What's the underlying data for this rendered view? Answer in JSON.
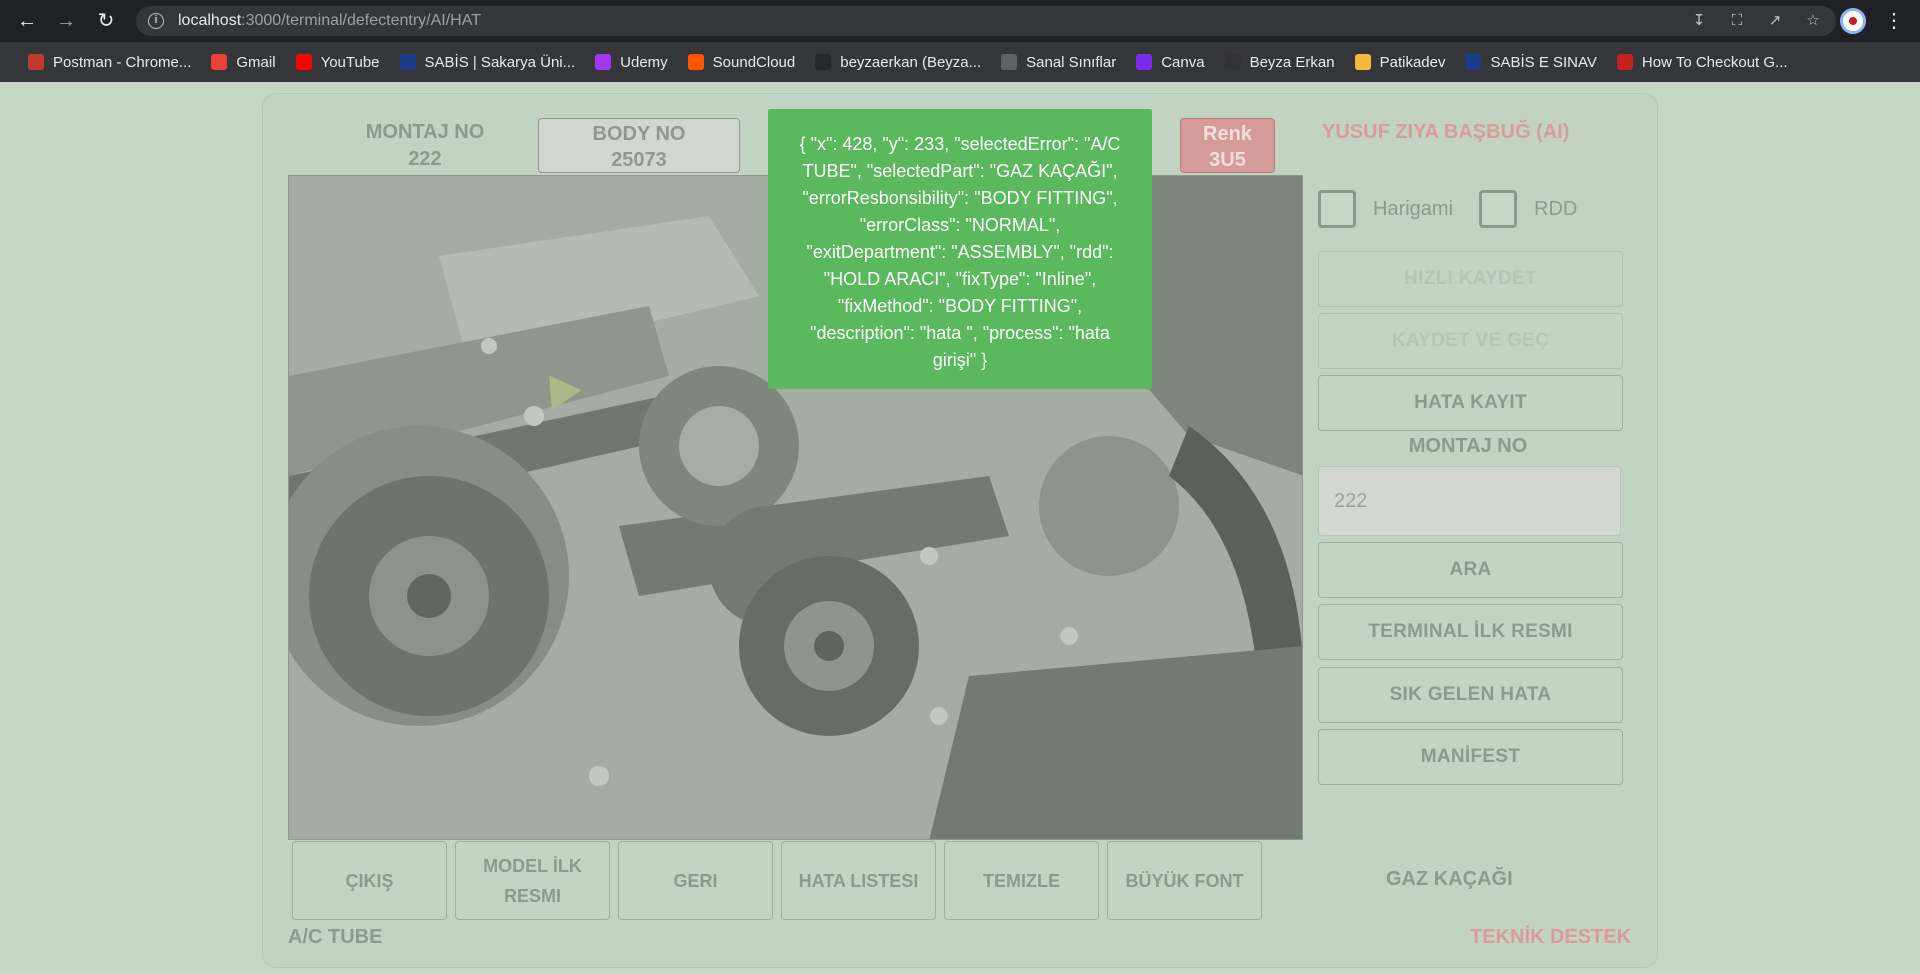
{
  "browser": {
    "url_host": "localhost",
    "url_path": ":3000/terminal/defectentry/AI/HAT",
    "bookmarks": [
      {
        "label": "Postman - Chrome...",
        "icon": "postman-icon",
        "color": "#c0392b"
      },
      {
        "label": "Gmail",
        "icon": "gmail-icon",
        "color": "#ea4335"
      },
      {
        "label": "YouTube",
        "icon": "youtube-icon",
        "color": "#ff0000"
      },
      {
        "label": "SABİS | Sakarya Üni...",
        "icon": "sabis-icon",
        "color": "#1a3a8a"
      },
      {
        "label": "Udemy",
        "icon": "udemy-icon",
        "color": "#a435f0"
      },
      {
        "label": "SoundCloud",
        "icon": "soundcloud-icon",
        "color": "#ff5500"
      },
      {
        "label": "beyzaerkan (Beyza...",
        "icon": "github-icon",
        "color": "#24292e"
      },
      {
        "label": "Sanal Sınıflar",
        "icon": "globe-icon",
        "color": "#5f6368"
      },
      {
        "label": "Canva",
        "icon": "canva-icon",
        "color": "#7d2ae8"
      },
      {
        "label": "Beyza Erkan",
        "icon": "be-icon",
        "color": "#333333"
      },
      {
        "label": "Patikadev",
        "icon": "patika-icon",
        "color": "#f6b73c"
      },
      {
        "label": "SABİS E SINAV",
        "icon": "sabis-icon",
        "color": "#1a3a8a"
      },
      {
        "label": "How To Checkout G...",
        "icon": "checkout-icon",
        "color": "#c5221f"
      }
    ]
  },
  "header": {
    "montaj_label": "MONTAJ NO",
    "montaj_value": "222",
    "body_label": "BODY NO",
    "body_value": "25073",
    "renk_label": "Renk",
    "renk_value": "3U5",
    "user": "YUSUF ZIYA BAŞBUĞ (AI)"
  },
  "popup": {
    "text": "{ \"x\": 428, \"y\": 233, \"selectedError\": \"A/C TUBE\", \"selectedPart\": \"GAZ KAÇAĞI\", \"errorResbonsibility\": \"BODY FITTING\", \"errorClass\": \"NORMAL\", \"exitDepartment\": \"ASSEMBLY\", \"rdd\": \"HOLD ARACI\", \"fixType\": \"Inline\", \"fixMethod\": \"BODY FITTING\", \"description\": \"hata \", \"process\": \"hata girişi\" }"
  },
  "checkboxes": {
    "harigami": "Harigami",
    "rdd": "RDD"
  },
  "sidebar": {
    "hizli_kaydet": "HIZLI KAYDET",
    "kaydet_ve_gec": "KAYDET VE GEÇ",
    "hata_kayit": "HATA KAYIT",
    "montaj_title": "MONTAJ NO",
    "montaj_input_value": "222",
    "ara": "ARA",
    "terminal_ilk_resmi": "TERMINAL İLK RESMI",
    "sik_gelen_hata": "SIK GELEN HATA",
    "manifest": "MANİFEST"
  },
  "bottom": {
    "cikis": "ÇIKIŞ",
    "model_ilk_resmi": "MODEL İLK RESMI",
    "geri": "GERI",
    "hata_listesi": "HATA LISTESI",
    "temizle": "TEMIZLE",
    "buyuk_font": "BÜYÜK FONT",
    "selected_part": "GAZ KAÇAĞI",
    "selected_error": "A/C TUBE",
    "teknik_destek": "TEKNİK DESTEK"
  }
}
